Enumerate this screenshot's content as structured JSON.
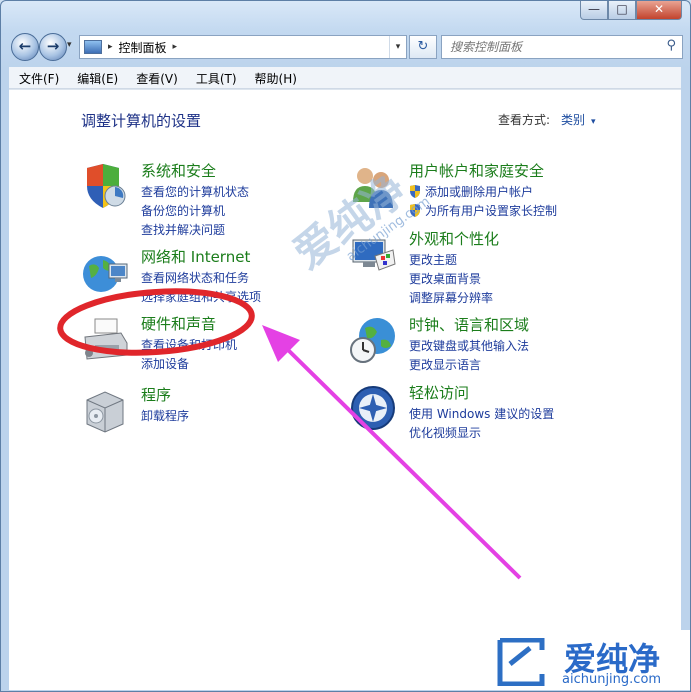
{
  "window": {
    "minimize": "—",
    "maximize": "□",
    "close": "✕"
  },
  "nav": {
    "back_icon": "arrow-left",
    "forward_icon": "arrow-right",
    "refresh": "↻",
    "address_sep1": "▸",
    "address_path": "控制面板",
    "address_sep2": "▸",
    "address_dropdown": "▾"
  },
  "search": {
    "placeholder": "搜索控制面板",
    "icon": "⚲"
  },
  "menu": {
    "file": "文件(F)",
    "edit": "编辑(E)",
    "view": "查看(V)",
    "tools": "工具(T)",
    "help": "帮助(H)"
  },
  "page": {
    "title": "调整计算机的设置",
    "view_by_label": "查看方式:",
    "view_by_value": "类别",
    "view_by_arrow": "▾"
  },
  "categories": {
    "system": {
      "title": "系统和安全",
      "links": [
        "查看您的计算机状态",
        "备份您的计算机",
        "查找并解决问题"
      ]
    },
    "network": {
      "title": "网络和 Internet",
      "links": [
        "查看网络状态和任务",
        "选择家庭组和共享选项"
      ]
    },
    "hardware": {
      "title": "硬件和声音",
      "links": [
        "查看设备和打印机",
        "添加设备"
      ]
    },
    "programs": {
      "title": "程序",
      "links": [
        "卸载程序"
      ]
    },
    "users": {
      "title": "用户帐户和家庭安全",
      "links": [
        "添加或删除用户帐户",
        "为所有用户设置家长控制"
      ]
    },
    "appearance": {
      "title": "外观和个性化",
      "links": [
        "更改主题",
        "更改桌面背景",
        "调整屏幕分辨率"
      ]
    },
    "clock": {
      "title": "时钟、语言和区域",
      "links": [
        "更改键盘或其他输入法",
        "更改显示语言"
      ]
    },
    "ease": {
      "title": "轻松访问",
      "links": [
        "使用 Windows 建议的设置",
        "优化视频显示"
      ]
    }
  },
  "watermark": {
    "center_text": "爱纯净",
    "center_url": "aichunjing.com",
    "brand_text": "爱纯净",
    "brand_url": "aichunjing.com"
  },
  "colors": {
    "category_green": "#1b7d1b",
    "link_blue": "#1e3c9c",
    "title_blue": "#1e3287",
    "annotation_red": "#e0262b",
    "arrow_magenta": "#e441e4"
  }
}
